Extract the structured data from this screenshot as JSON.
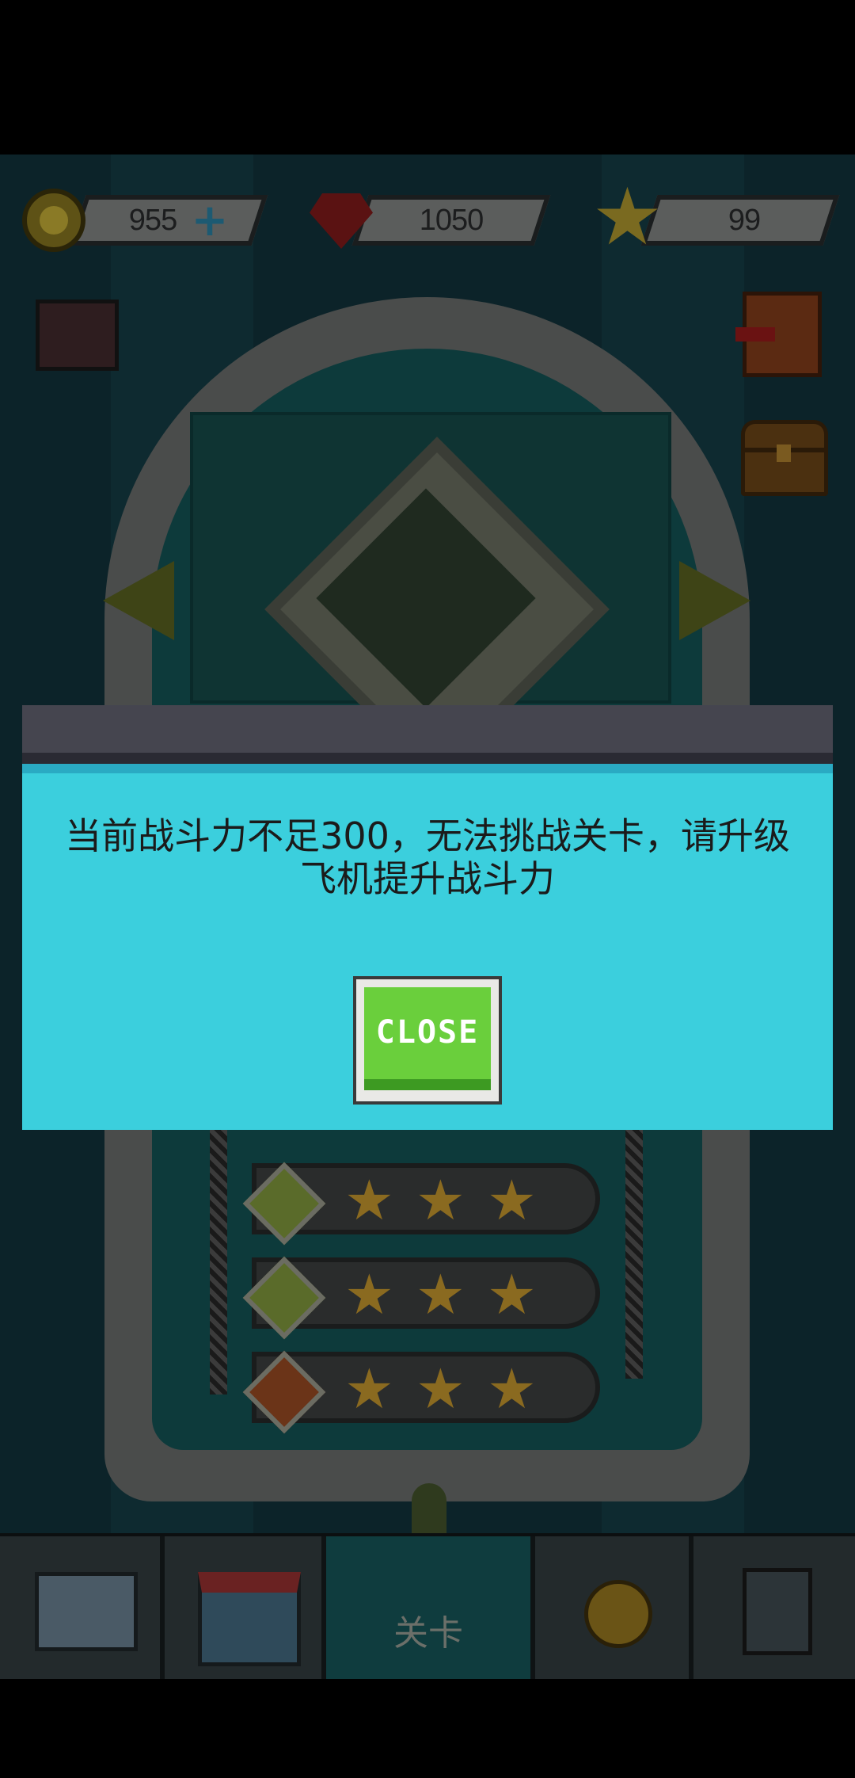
{
  "hud": {
    "coins": "955",
    "gems": "1050",
    "stars": "99",
    "coin_icon": "coin-icon",
    "gem_icon": "ruby-icon",
    "star_icon": "star-icon",
    "add_icon": "plus-icon"
  },
  "level_rows": [
    {
      "gem_color": "#5a6b2a",
      "stars": [
        "★",
        "★",
        "★"
      ]
    },
    {
      "gem_color": "#5a6b2a",
      "stars": [
        "★",
        "★",
        "★"
      ]
    },
    {
      "gem_color": "#6b3418",
      "stars": [
        "★",
        "★",
        "★"
      ]
    }
  ],
  "dialog": {
    "message": "当前战斗力不足300，无法挑战关卡，请升级飞机提升战斗力",
    "close_label": "CLOSE"
  },
  "nav": {
    "items": [
      {
        "icon": "hangar-icon"
      },
      {
        "icon": "shop-icon"
      },
      {
        "icon": "plane-icon",
        "label": "关卡",
        "active": true
      },
      {
        "icon": "medal-icon"
      },
      {
        "icon": "task-list-icon"
      }
    ]
  },
  "colors": {
    "dialog_bg": "#3bcfdd",
    "close_button": "#6acf3c",
    "overlay": "#0c2329"
  }
}
